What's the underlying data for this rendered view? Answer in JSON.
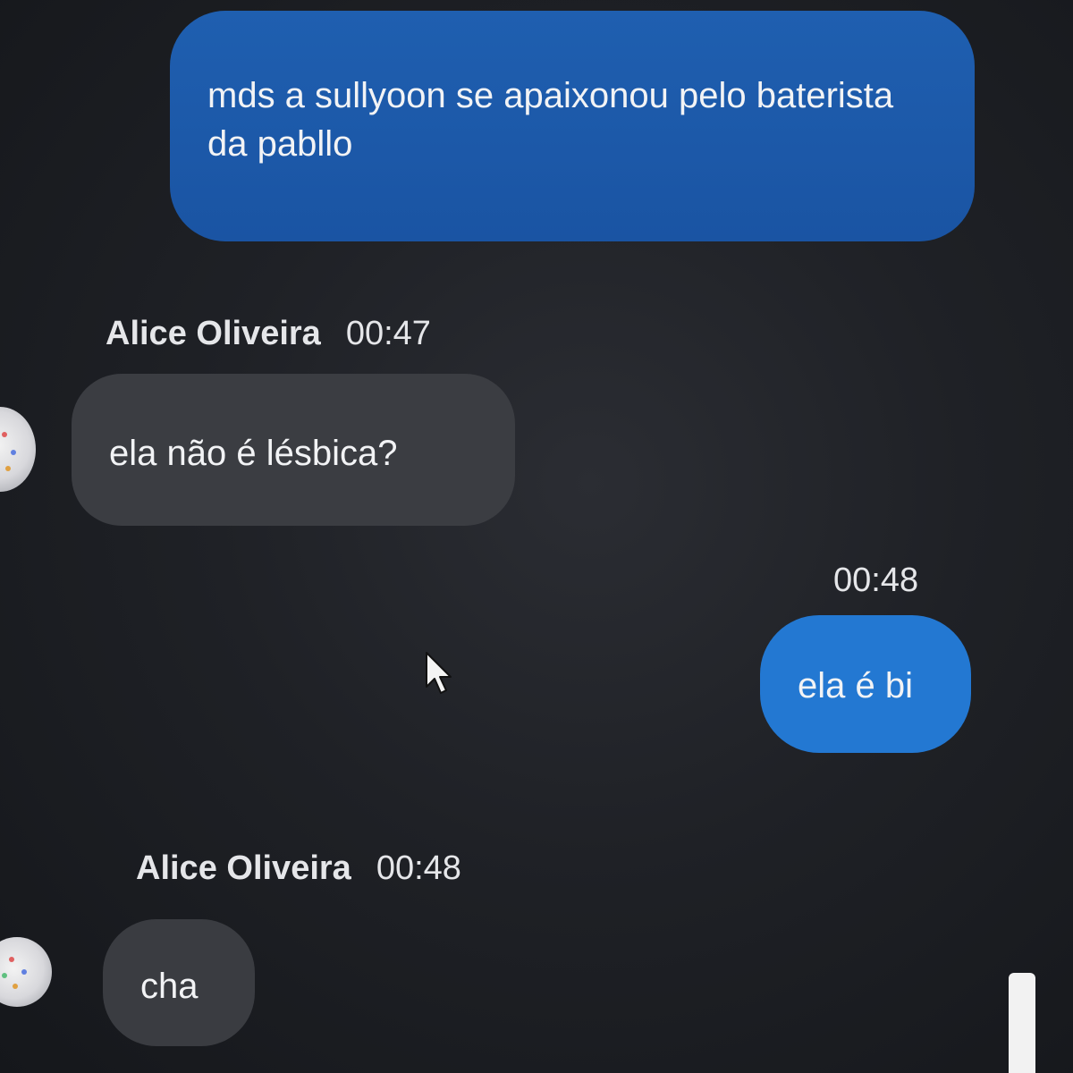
{
  "messages": {
    "out_1": {
      "text": "mds a sullyoon se apaixonou pelo baterista da pabllo"
    },
    "in_1": {
      "sender": "Alice Oliveira",
      "time": "00:47",
      "text": "ela não é lésbica?"
    },
    "out_2": {
      "time": "00:48",
      "text": "ela é bi"
    },
    "in_2": {
      "sender": "Alice Oliveira",
      "time": "00:48",
      "text": "cha"
    }
  },
  "colors": {
    "outgoing_bubble": "#1f5fb0",
    "outgoing_bubble_alt": "#2378d2",
    "incoming_bubble": "#3b3d42",
    "background": "#1f2126"
  },
  "icons": {
    "cursor": "mouse-pointer-icon",
    "avatar": "user-avatar"
  }
}
